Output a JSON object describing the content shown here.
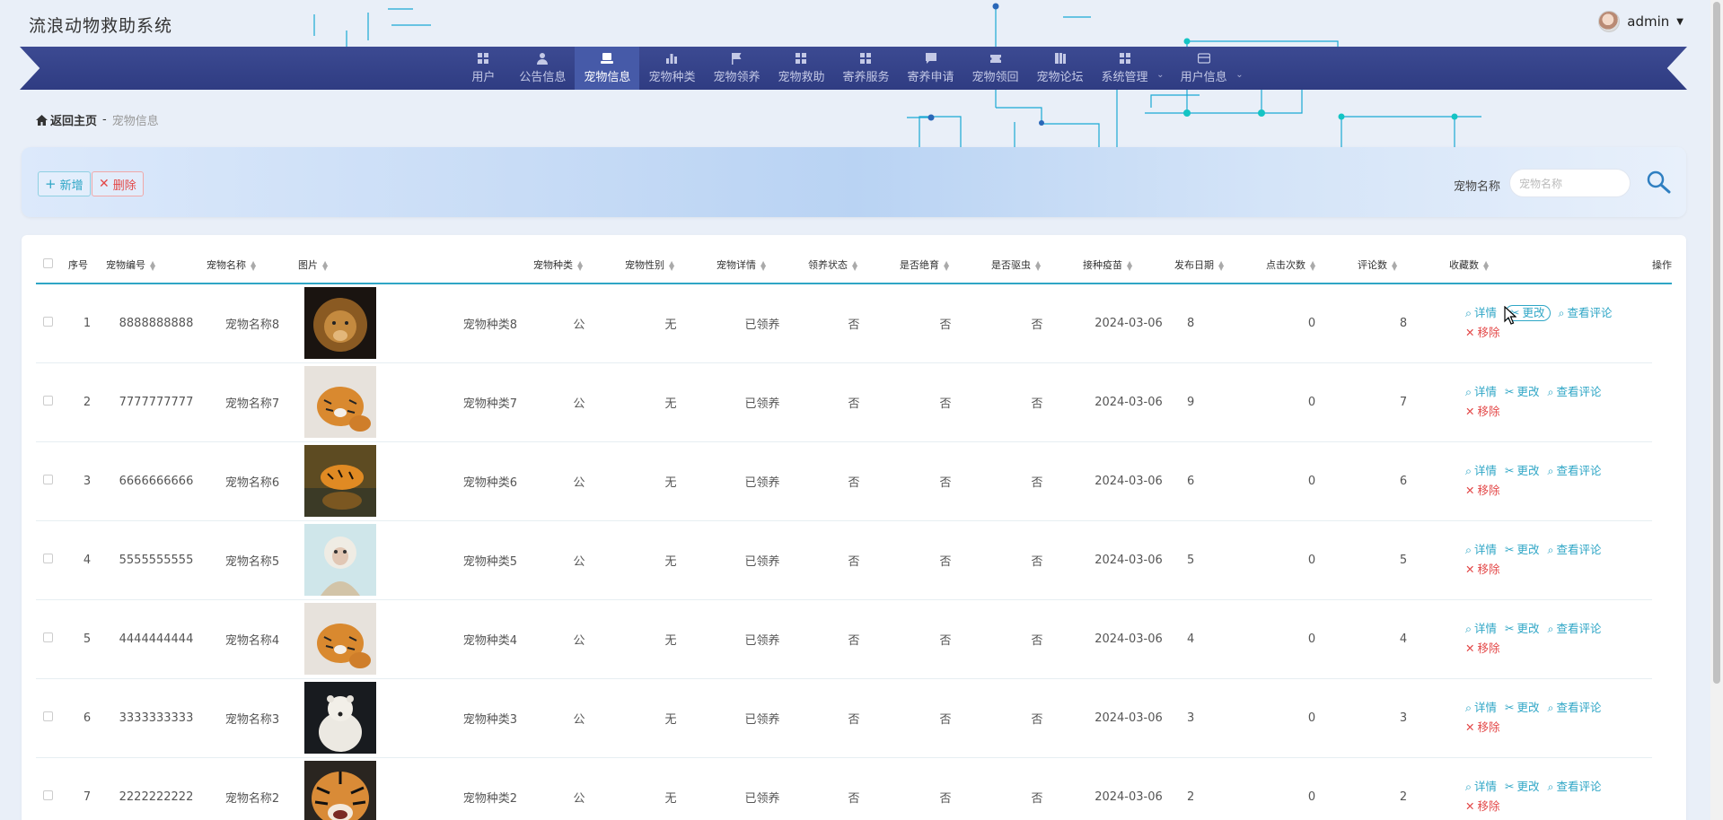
{
  "app": {
    "title": "流浪动物救助系统",
    "user": "admin"
  },
  "nav": [
    {
      "label": "用户",
      "icon": "grid-icon",
      "active": false
    },
    {
      "label": "公告信息",
      "icon": "person-icon",
      "active": false
    },
    {
      "label": "宠物信息",
      "icon": "laptop-icon",
      "active": true
    },
    {
      "label": "宠物种类",
      "icon": "bar-chart-icon",
      "active": false
    },
    {
      "label": "宠物领养",
      "icon": "flag-icon",
      "active": false
    },
    {
      "label": "宠物救助",
      "icon": "grid-icon",
      "active": false
    },
    {
      "label": "寄养服务",
      "icon": "grid-icon",
      "active": false
    },
    {
      "label": "寄养申请",
      "icon": "chat-icon",
      "active": false
    },
    {
      "label": "宠物领回",
      "icon": "ticket-icon",
      "active": false
    },
    {
      "label": "宠物论坛",
      "icon": "book-icon",
      "active": false
    },
    {
      "label": "系统管理",
      "icon": "grid-icon",
      "active": false,
      "dropdown": true
    },
    {
      "label": "用户信息",
      "icon": "card-icon",
      "active": false,
      "dropdown": true
    }
  ],
  "breadcrumb": {
    "home": "返回主页",
    "sep": "-",
    "current": "宠物信息"
  },
  "toolbar": {
    "add": "新增",
    "delete": "删除",
    "search_label": "宠物名称",
    "search_placeholder": "宠物名称"
  },
  "table": {
    "headers": [
      "序号",
      "宠物编号",
      "宠物名称",
      "图片",
      "宠物种类",
      "宠物性别",
      "宠物详情",
      "领养状态",
      "是否绝育",
      "是否驱虫",
      "接种疫苗",
      "发布日期",
      "点击次数",
      "评论数",
      "收藏数",
      "操作"
    ],
    "ops": {
      "detail": "详情",
      "edit": "更改",
      "comments": "查看评论",
      "remove": "移除"
    },
    "rows": [
      {
        "idx": "1",
        "code": "8888888888",
        "name": "宠物名称8",
        "image": "lion",
        "type": "宠物种类8",
        "gender": "公",
        "detail": "无",
        "status": "已领养",
        "neutered": "否",
        "dewormed": "否",
        "vaccinated": "否",
        "date": "2024-03-06",
        "clicks": "8",
        "comments": "0",
        "favs": "8"
      },
      {
        "idx": "2",
        "code": "7777777777",
        "name": "宠物名称7",
        "image": "tigers-snow",
        "type": "宠物种类7",
        "gender": "公",
        "detail": "无",
        "status": "已领养",
        "neutered": "否",
        "dewormed": "否",
        "vaccinated": "否",
        "date": "2024-03-06",
        "clicks": "9",
        "comments": "0",
        "favs": "7"
      },
      {
        "idx": "3",
        "code": "6666666666",
        "name": "宠物名称6",
        "image": "tiger-water",
        "type": "宠物种类6",
        "gender": "公",
        "detail": "无",
        "status": "已领养",
        "neutered": "否",
        "dewormed": "否",
        "vaccinated": "否",
        "date": "2024-03-06",
        "clicks": "6",
        "comments": "0",
        "favs": "6"
      },
      {
        "idx": "4",
        "code": "5555555555",
        "name": "宠物名称5",
        "image": "monkey",
        "type": "宠物种类5",
        "gender": "公",
        "detail": "无",
        "status": "已领养",
        "neutered": "否",
        "dewormed": "否",
        "vaccinated": "否",
        "date": "2024-03-06",
        "clicks": "5",
        "comments": "0",
        "favs": "5"
      },
      {
        "idx": "5",
        "code": "4444444444",
        "name": "宠物名称4",
        "image": "tigers-snow",
        "type": "宠物种类4",
        "gender": "公",
        "detail": "无",
        "status": "已领养",
        "neutered": "否",
        "dewormed": "否",
        "vaccinated": "否",
        "date": "2024-03-06",
        "clicks": "4",
        "comments": "0",
        "favs": "4"
      },
      {
        "idx": "6",
        "code": "3333333333",
        "name": "宠物名称3",
        "image": "polar-bear",
        "type": "宠物种类3",
        "gender": "公",
        "detail": "无",
        "status": "已领养",
        "neutered": "否",
        "dewormed": "否",
        "vaccinated": "否",
        "date": "2024-03-06",
        "clicks": "3",
        "comments": "0",
        "favs": "3"
      },
      {
        "idx": "7",
        "code": "2222222222",
        "name": "宠物名称2",
        "image": "tiger-face",
        "type": "宠物种类2",
        "gender": "公",
        "detail": "无",
        "status": "已领养",
        "neutered": "否",
        "dewormed": "否",
        "vaccinated": "否",
        "date": "2024-03-06",
        "clicks": "2",
        "comments": "0",
        "favs": "2"
      }
    ]
  }
}
